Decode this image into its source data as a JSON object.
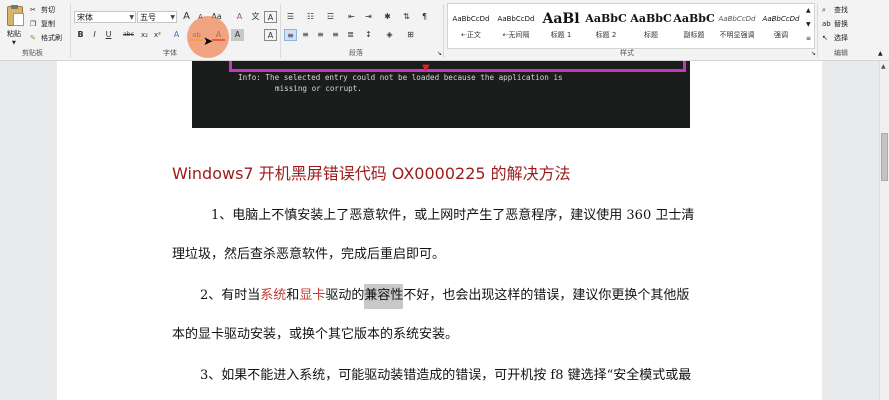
{
  "clipboard": {
    "paste_label": "粘贴",
    "cut_label": "剪切",
    "copy_label": "复制",
    "format_painter_label": "格式刷",
    "group_label": "剪贴板"
  },
  "font": {
    "font_name": "宋体",
    "font_size": "五号",
    "grow_label": "A",
    "shrink_label": "A",
    "case_label": "Aa",
    "clear_label": "A",
    "phonetic_label": "文",
    "border_label": "A",
    "bold_label": "B",
    "italic_label": "I",
    "underline_label": "U",
    "strike_label": "abc",
    "sub_label": "x₂",
    "sup_label": "x²",
    "effects_label": "A",
    "highlight_label": "ab",
    "color_label": "A",
    "shade_label": "A",
    "char_border_label": "A",
    "group_label": "字体"
  },
  "paragraph": {
    "group_label": "段落"
  },
  "styles": {
    "group_label": "样式",
    "items": [
      {
        "preview": "AaBbCcDd",
        "name": "⇠正文"
      },
      {
        "preview": "AaBbCcDd",
        "name": "⇠无间隔"
      },
      {
        "preview": "AaBl",
        "name": "标题 1"
      },
      {
        "preview": "AaBbC",
        "name": "标题 2"
      },
      {
        "preview": "AaBbC",
        "name": "标题"
      },
      {
        "preview": "AaBbC",
        "name": "副标题"
      },
      {
        "preview": "AaBbCcDd",
        "name": "不明显强调"
      },
      {
        "preview": "AaBbCcDd",
        "name": "强调"
      }
    ]
  },
  "editing": {
    "find_label": "查找",
    "replace_label": "替换",
    "select_label": "选择",
    "group_label": "编辑"
  },
  "screenshot_text": {
    "line1": "Info: The selected entry could not be loaded because the application is",
    "line2": "missing or corrupt."
  },
  "document": {
    "heading": "Windows7 开机黑屏错误代码 OX0000225 的解决方法",
    "p1_line1": "1、电脑上不慎安装上了恶意软件，或上网时产生了恶意程序，建议使用 360 卫士清",
    "p1_line2": "理垃圾，然后查杀恶意软件，完成后重启即可。",
    "p2_pre": "2、有时当",
    "p2_red1": "系统",
    "p2_and": "和",
    "p2_red2": "显卡",
    "p2_mid": "驱动的",
    "p2_sel": "兼容性",
    "p2_post": "不好，也会出现这样的错误，建议你更换个其他版",
    "p2_line2": "本的显卡驱动安装，或换个其它版本的系统安装。",
    "p3_line1": "3、如果不能进入系统，可能驱动装错造成的错误，可开机按 f8 键选择“安全模式或最"
  },
  "colors": {
    "heading": "#9b1b1b",
    "red_text": "#c0392b",
    "selection": "#c8c8c8",
    "cursor_circle": "#f08a5a",
    "magenta_box": "#c039c0"
  }
}
